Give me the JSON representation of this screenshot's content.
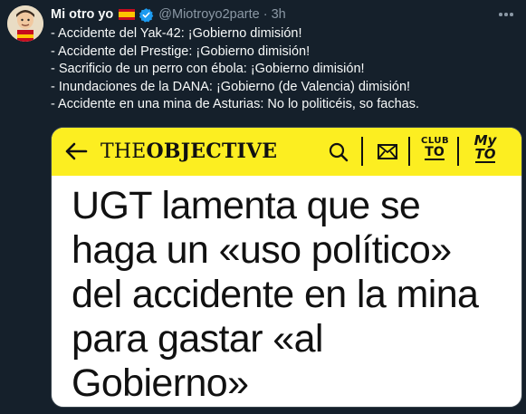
{
  "tweet": {
    "author_name": "Mi otro yo",
    "flag": "spain-flag-icon",
    "verified": "verified-badge-icon",
    "handle": "@Miotroyo2parte",
    "separator": "·",
    "time": "3h",
    "lines": [
      "- Accidente del Yak-42: ¡Gobierno dimisión!",
      "- Accidente del Prestige: ¡Gobierno dimisión!",
      "- Sacrificio de un perro con ébola: ¡Gobierno dimisión!",
      "- Inundaciones de la DANA: ¡Gobierno (de Valencia) dimisión!",
      "- Accidente en una mina de Asturias: No lo politicéis, so fachas."
    ]
  },
  "media": {
    "brand_light": "THE",
    "brand_heavy": "OBJECTIVE",
    "club_top": "CLUB",
    "club_bottom": "TO",
    "my_top": "My",
    "my_bottom": "TO",
    "headline_lines": [
      "UGT lamenta que se",
      "haga un «uso político»",
      "del accidente en la mina",
      "para gastar «al",
      "Gobierno»"
    ]
  },
  "colors": {
    "background": "#15202b",
    "text_primary": "#f7f9f9",
    "text_secondary": "#8b98a5",
    "verified_blue": "#1d9bf0",
    "brand_yellow": "#fcee21"
  }
}
